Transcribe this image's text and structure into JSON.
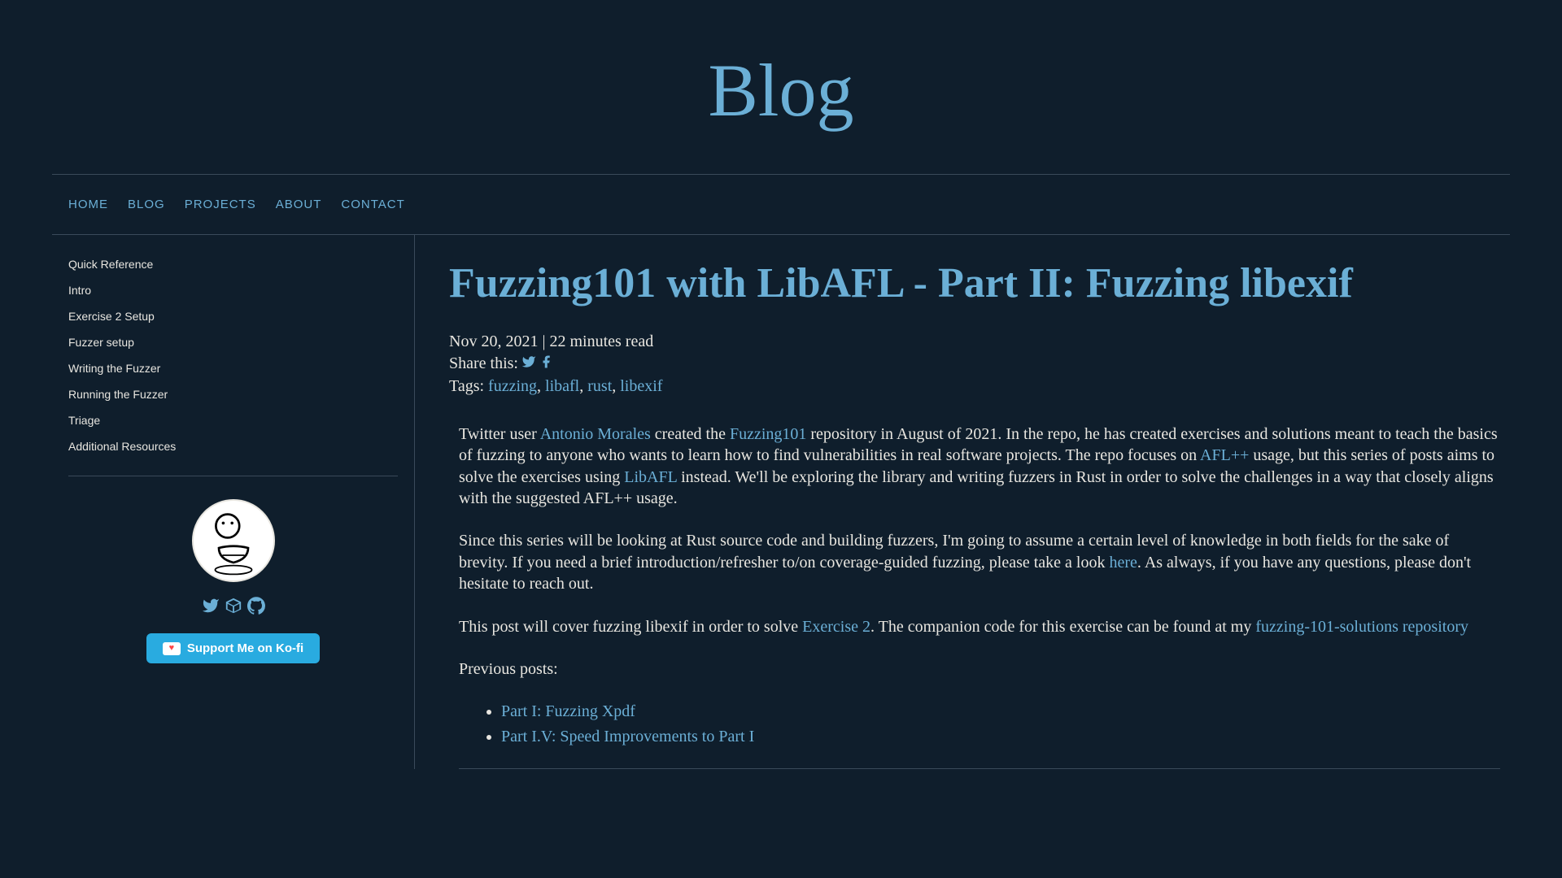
{
  "header": {
    "title": "Blog"
  },
  "nav": {
    "items": [
      {
        "label": "HOME"
      },
      {
        "label": "BLOG"
      },
      {
        "label": "PROJECTS"
      },
      {
        "label": "ABOUT"
      },
      {
        "label": "CONTACT"
      }
    ]
  },
  "toc": {
    "items": [
      {
        "label": "Quick Reference"
      },
      {
        "label": "Intro"
      },
      {
        "label": "Exercise 2 Setup"
      },
      {
        "label": "Fuzzer setup"
      },
      {
        "label": "Writing the Fuzzer"
      },
      {
        "label": "Running the Fuzzer"
      },
      {
        "label": "Triage"
      },
      {
        "label": "Additional Resources"
      }
    ]
  },
  "profile": {
    "kofi_label": "Support Me on Ko-fi"
  },
  "post": {
    "title": "Fuzzing101 with LibAFL - Part II: Fuzzing libexif",
    "date": "Nov 20, 2021",
    "read_time": "22 minutes read",
    "share_label": "Share this:",
    "tags_label": "Tags:",
    "tags": [
      {
        "label": "fuzzing"
      },
      {
        "label": "libafl"
      },
      {
        "label": "rust"
      },
      {
        "label": "libexif"
      }
    ],
    "para1": {
      "t1": "Twitter user ",
      "l1": "Antonio Morales",
      "t2": " created the ",
      "l2": "Fuzzing101",
      "t3": " repository in August of 2021. In the repo, he has created exercises and solutions meant to teach the basics of fuzzing to anyone who wants to learn how to find vulnerabilities in real software projects. The repo focuses on ",
      "l3": "AFL++",
      "t4": " usage, but this series of posts aims to solve the exercises using ",
      "l4": "LibAFL",
      "t5": " instead. We'll be exploring the library and writing fuzzers in Rust in order to solve the challenges in a way that closely aligns with the suggested AFL++ usage."
    },
    "para2": {
      "t1": "Since this series will be looking at Rust source code and building fuzzers, I'm going to assume a certain level of knowledge in both fields for the sake of brevity. If you need a brief introduction/refresher to/on coverage-guided fuzzing, please take a look ",
      "l1": "here",
      "t2": ". As always, if you have any questions, please don't hesitate to reach out."
    },
    "para3": {
      "t1": "This post will cover fuzzing libexif in order to solve ",
      "l1": "Exercise 2",
      "t2": ". The companion code for this exercise can be found at my ",
      "l2": "fuzzing-101-solutions repository"
    },
    "para4": {
      "t1": "Previous posts:"
    },
    "prev_links": [
      {
        "label": "Part I: Fuzzing Xpdf"
      },
      {
        "label": "Part I.V: Speed Improvements to Part I"
      }
    ]
  }
}
